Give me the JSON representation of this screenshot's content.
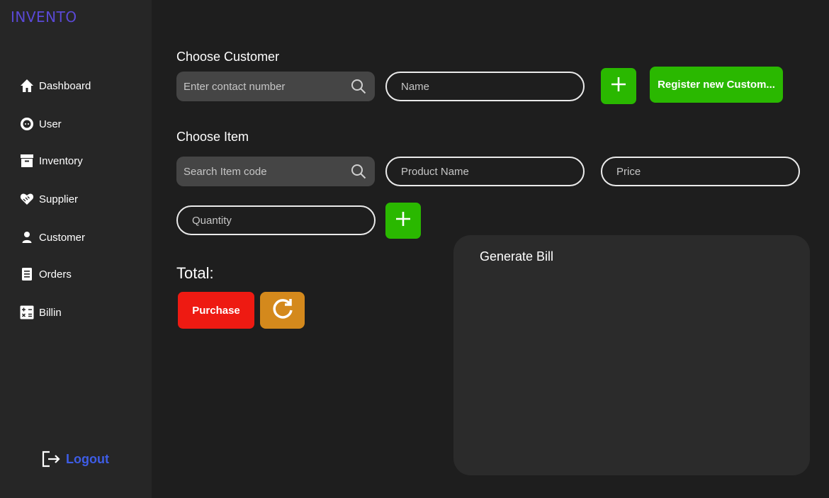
{
  "app": {
    "brand": "INVENTO"
  },
  "sidebar": {
    "items": [
      {
        "label": "Dashboard",
        "icon": "home-icon"
      },
      {
        "label": "User",
        "icon": "user-circle-icon"
      },
      {
        "label": "Inventory",
        "icon": "archive-box-icon"
      },
      {
        "label": "Supplier",
        "icon": "handshake-heart-icon"
      },
      {
        "label": "Customer",
        "icon": "person-icon"
      },
      {
        "label": "Orders",
        "icon": "document-icon"
      },
      {
        "label": "Billin",
        "icon": "calculator-icon"
      }
    ],
    "logout": {
      "label": "Logout",
      "icon": "logout-icon"
    }
  },
  "customer": {
    "title": "Choose Customer",
    "contact_placeholder": "Enter contact number",
    "name_placeholder": "Name",
    "register_label": "Register new Custom..."
  },
  "item": {
    "title": "Choose Item",
    "code_placeholder": "Search Item code",
    "product_placeholder": "Product Name",
    "price_placeholder": "Price",
    "quantity_placeholder": "Quantity"
  },
  "summary": {
    "total_label": "Total:",
    "purchase_label": "Purchase"
  },
  "bill": {
    "title": "Generate Bill"
  },
  "colors": {
    "background": "#1e1e1e",
    "sidebar": "#262626",
    "brand": "#5a49d6",
    "accent_green": "#2ab800",
    "purchase_red": "#ee1a12",
    "refresh_orange": "#d4891c",
    "logout_blue": "#3e5de6",
    "panel": "#2b2b2b"
  }
}
